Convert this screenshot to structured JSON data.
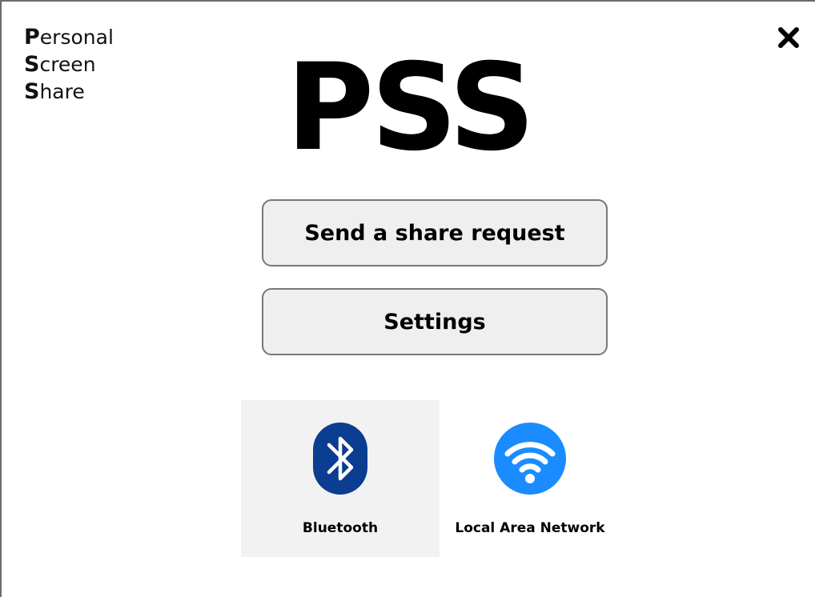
{
  "window": {
    "close_icon": "close-icon"
  },
  "acronym": {
    "rows": [
      {
        "initial": "P",
        "rest": "ersonal"
      },
      {
        "initial": "S",
        "rest": "creen"
      },
      {
        "initial": "S",
        "rest": "hare"
      }
    ]
  },
  "logo": {
    "text": "PSS"
  },
  "buttons": {
    "share_request_label": "Send a share request",
    "settings_label": "Settings"
  },
  "connections": {
    "selected": "Bluetooth",
    "items": [
      {
        "label": "Bluetooth",
        "icon": "bluetooth-icon",
        "color": "#0b3d91"
      },
      {
        "label": "Local Area Network",
        "icon": "wifi-icon",
        "color": "#1a8cff"
      }
    ]
  }
}
